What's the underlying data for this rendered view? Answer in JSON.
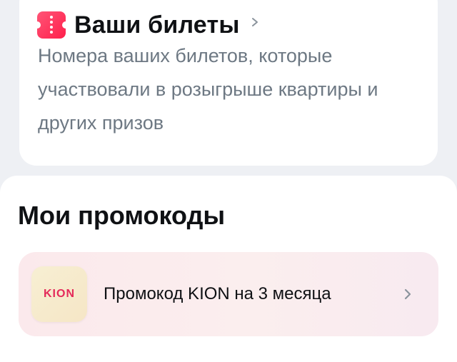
{
  "tickets": {
    "title": "Ваши билеты",
    "description": "Номера ваших билетов, которые участвовали в розыгрыше квартиры и других призов",
    "icon": "ticket-icon",
    "chevron_icon": "chevron-right-icon",
    "accent_color": "#ff2d55"
  },
  "promocodes": {
    "heading": "Мои промокоды",
    "items": [
      {
        "logo_text": "KION",
        "label": "Промокод KION на 3 месяца",
        "chevron_icon": "chevron-right-icon"
      }
    ]
  }
}
